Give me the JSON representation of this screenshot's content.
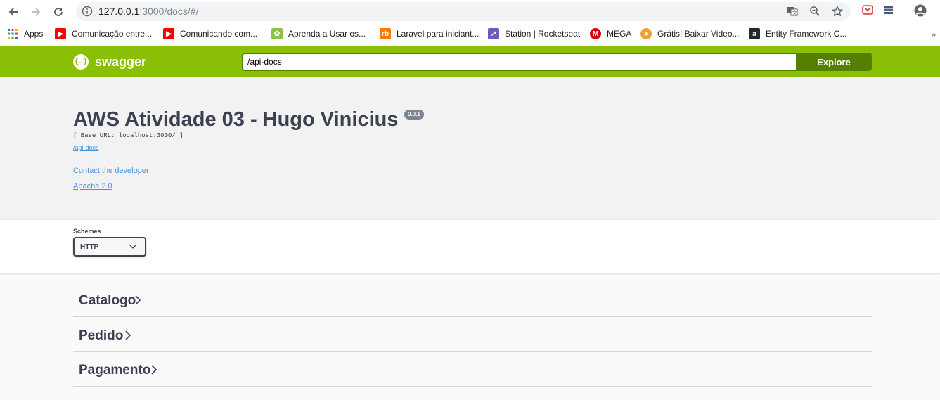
{
  "browser": {
    "url_host": "127.0.0.1",
    "url_rest": ":3000/docs/#/",
    "bookmarks": [
      {
        "label": "Apps",
        "icon": "apps-grid-icon"
      },
      {
        "label": "Comunicação entre...",
        "icon": "youtube-icon"
      },
      {
        "label": "Comunicando com...",
        "icon": "youtube-icon"
      },
      {
        "label": "Aprenda a Usar os...",
        "icon": "site-icon"
      },
      {
        "label": "Laravel para iniciant...",
        "icon": "site-icon"
      },
      {
        "label": "Station | Rocketseat",
        "icon": "rocketseat-icon"
      },
      {
        "label": "MEGA",
        "icon": "mega-icon"
      },
      {
        "label": "Grátis! Baixar Video...",
        "icon": "site-icon"
      },
      {
        "label": "Entity Framework C...",
        "icon": "site-icon"
      }
    ],
    "bookmarks_more": "»"
  },
  "topbar": {
    "logo_mark": "{…}",
    "logo_text": "swagger",
    "api_url": "/api-docs",
    "explore_label": "Explore"
  },
  "info": {
    "title": "AWS Atividade 03 - Hugo Vinicius",
    "version": "0.0.1",
    "base_url": "[ Base URL: localhost:3000/ ]",
    "spec_link": "/api-docs",
    "contact_link": "Contact the developer",
    "license_link": "Apache 2.0"
  },
  "schemes": {
    "label": "Schemes",
    "selected": "HTTP"
  },
  "tags": [
    {
      "name": "Catalogo"
    },
    {
      "name": "Pedido"
    },
    {
      "name": "Pagamento"
    }
  ],
  "colors": {
    "topbar": "#89bf04",
    "explore": "#547f00",
    "link": "#4990e2",
    "text": "#3b4151"
  }
}
